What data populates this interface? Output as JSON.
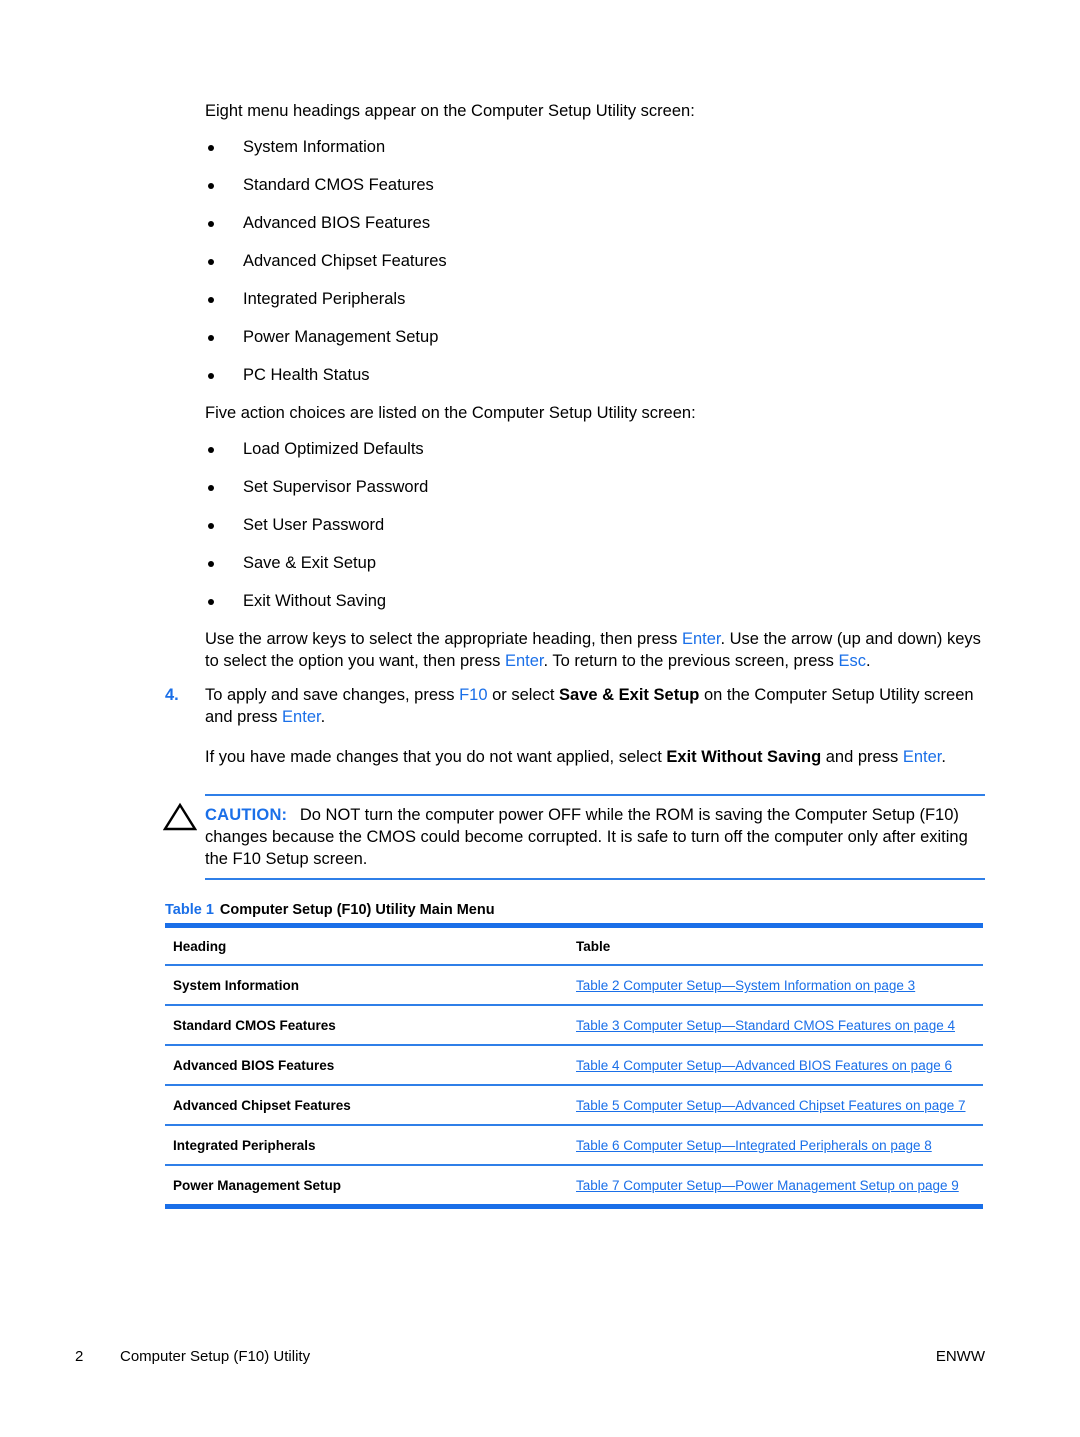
{
  "body": {
    "intro_menu": "Eight menu headings appear on the Computer Setup Utility screen:",
    "menu_headings": [
      "System Information",
      "Standard CMOS Features",
      "Advanced BIOS Features",
      "Advanced Chipset Features",
      "Integrated Peripherals",
      "Power Management Setup",
      "PC Health Status"
    ],
    "intro_actions": "Five action choices are listed on the Computer Setup Utility screen:",
    "action_choices": [
      "Load Optimized Defaults",
      "Set Supervisor Password",
      "Set User Password",
      "Save & Exit Setup",
      "Exit Without Saving"
    ],
    "navigation_paragraph": {
      "part1": "Use the arrow keys to select the appropriate heading, then press ",
      "key1": "Enter",
      "part2": ". Use the arrow (up and down) keys to select the option you want, then press ",
      "key2": "Enter",
      "part3": ". To return to the previous screen, press ",
      "key3": "Esc",
      "part4": "."
    },
    "step": {
      "number": "4.",
      "part1": "To apply and save changes, press ",
      "key1": "F10",
      "part2": " or select ",
      "bold1": "Save & Exit Setup",
      "part3": " on the Computer Setup Utility screen and press ",
      "key2": "Enter",
      "part4": ".",
      "sub_part1": "If you have made changes that you do not want applied, select ",
      "sub_bold1": "Exit Without Saving",
      "sub_part2": " and press ",
      "sub_key1": "Enter",
      "sub_part3": "."
    }
  },
  "caution": {
    "label": "CAUTION:",
    "text": "Do NOT turn the computer power OFF while the ROM is saving the Computer Setup (F10) changes because the CMOS could become corrupted. It is safe to turn off the computer only after exiting the F10 Setup screen."
  },
  "table": {
    "caption_number": "Table 1",
    "caption_title": "Computer Setup (F10) Utility Main Menu",
    "columns": [
      "Heading",
      "Table"
    ],
    "rows": [
      {
        "heading": "System Information",
        "link": "Table 2 Computer Setup—System Information on page 3"
      },
      {
        "heading": "Standard CMOS Features",
        "link": "Table 3 Computer Setup—Standard CMOS Features on page 4"
      },
      {
        "heading": "Advanced BIOS Features",
        "link": "Table 4 Computer Setup—Advanced BIOS Features on page 6"
      },
      {
        "heading": "Advanced Chipset Features",
        "link": "Table 5 Computer Setup—Advanced Chipset Features on page 7"
      },
      {
        "heading": "Integrated Peripherals",
        "link": "Table 6 Computer Setup—Integrated Peripherals on page 8"
      },
      {
        "heading": "Power Management Setup",
        "link": "Table 7 Computer Setup—Power Management Setup on page 9"
      }
    ]
  },
  "footer": {
    "page_number": "2",
    "chapter_title": "Computer Setup (F10) Utility",
    "locale": "ENWW"
  },
  "colors": {
    "link_blue": "#1a6fe8",
    "rule_blue": "#2f7fe8",
    "text_black": "#000000"
  }
}
